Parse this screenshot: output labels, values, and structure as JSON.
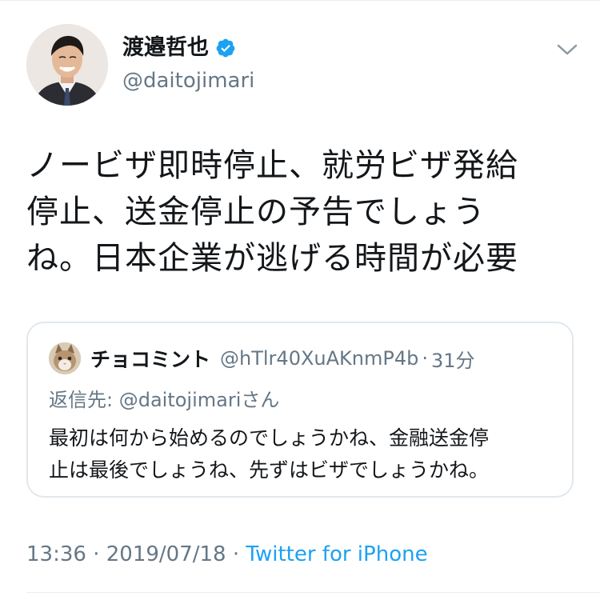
{
  "author": {
    "display_name": "渡邉哲也",
    "handle": "@daitojimari",
    "verified": true
  },
  "tweet": {
    "lines": [
      "ノービザ即時停止、就労ビザ発給",
      "停止、送金停止の予告でしょう",
      "ね。日本企業が逃げる時間が必要"
    ]
  },
  "quoted": {
    "display_name": "チョコミント",
    "handle": "@hTlr40XuAKnmP4b",
    "separator": "·",
    "time": "31分",
    "reply_to": "返信先: @daitojimariさん",
    "lines": [
      "最初は何から始めるのでしょうかね、金融送金停",
      "止は最後でしょうね、先ずはビザでしょうかね。"
    ]
  },
  "meta": {
    "time": "13:36",
    "date": "2019/07/18",
    "separator": "·",
    "source": "Twitter for iPhone"
  },
  "icons": {
    "verified": "verified-badge-icon",
    "menu": "chevron-down-icon"
  },
  "colors": {
    "accent": "#1da1f2",
    "secondary_text": "#657786",
    "border": "#e1e8ed"
  }
}
